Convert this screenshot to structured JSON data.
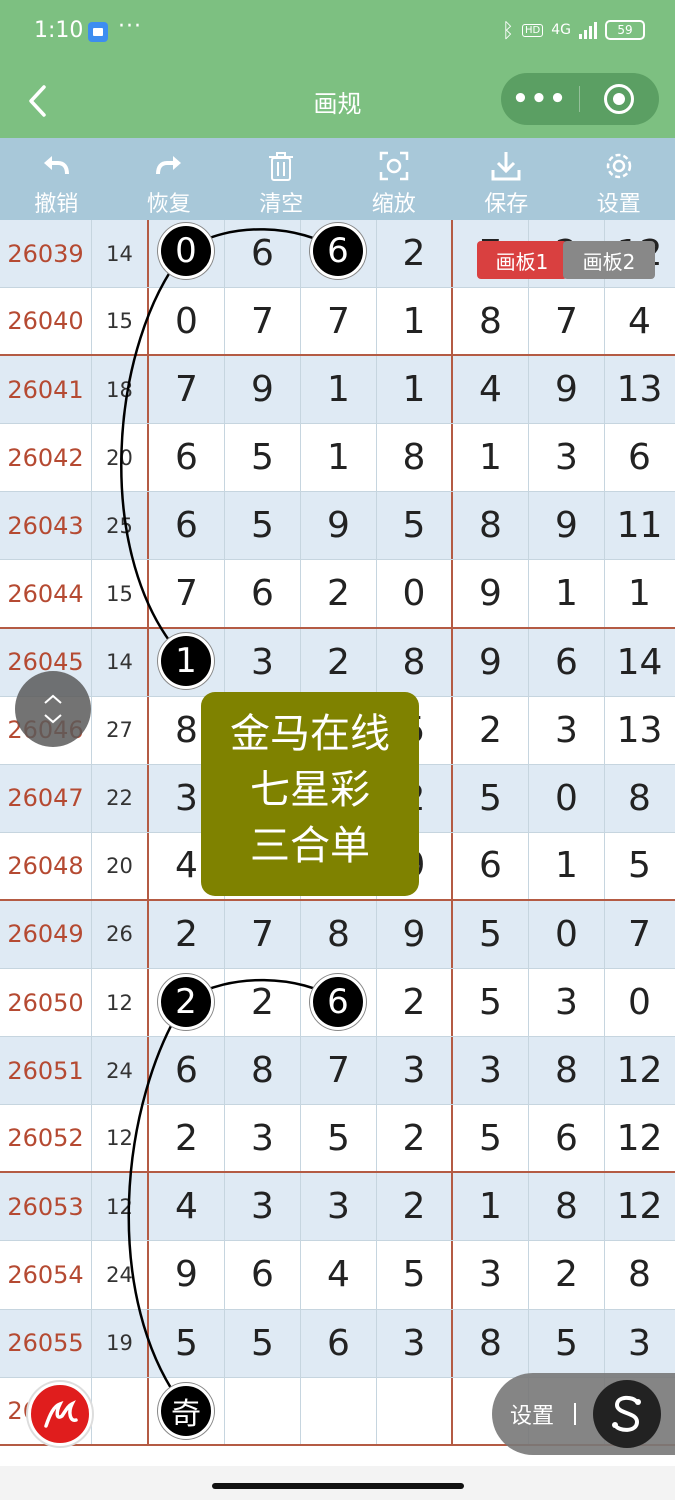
{
  "status_bar": {
    "time": "1:10",
    "dots": "···",
    "hd": "HD",
    "network": "4G",
    "battery": "59"
  },
  "nav": {
    "title": "画规",
    "more": "•••"
  },
  "toolbar": [
    {
      "label": "撤销",
      "icon": "undo-icon"
    },
    {
      "label": "恢复",
      "icon": "redo-icon"
    },
    {
      "label": "清空",
      "icon": "trash-icon"
    },
    {
      "label": "缩放",
      "icon": "zoom-icon"
    },
    {
      "label": "保存",
      "icon": "download-icon"
    },
    {
      "label": "设置",
      "icon": "gear-icon"
    }
  ],
  "boards": {
    "board1": "画板1",
    "board2": "画板2"
  },
  "rows": [
    {
      "id": "26039",
      "sum": "14",
      "n": [
        "0",
        "6",
        "6",
        "2",
        "7",
        "2",
        "12"
      ]
    },
    {
      "id": "26040",
      "sum": "15",
      "n": [
        "0",
        "7",
        "7",
        "1",
        "8",
        "7",
        "4"
      ]
    },
    {
      "id": "26041",
      "sum": "18",
      "n": [
        "7",
        "9",
        "1",
        "1",
        "4",
        "9",
        "13"
      ]
    },
    {
      "id": "26042",
      "sum": "20",
      "n": [
        "6",
        "5",
        "1",
        "8",
        "1",
        "3",
        "6"
      ]
    },
    {
      "id": "26043",
      "sum": "25",
      "n": [
        "6",
        "5",
        "9",
        "5",
        "8",
        "9",
        "11"
      ]
    },
    {
      "id": "26044",
      "sum": "15",
      "n": [
        "7",
        "6",
        "2",
        "0",
        "9",
        "1",
        "1"
      ]
    },
    {
      "id": "26045",
      "sum": "14",
      "n": [
        "1",
        "3",
        "2",
        "8",
        "9",
        "6",
        "14"
      ]
    },
    {
      "id": "26046",
      "sum": "27",
      "n": [
        "8",
        "",
        "",
        "5",
        "2",
        "3",
        "13"
      ]
    },
    {
      "id": "26047",
      "sum": "22",
      "n": [
        "3",
        "",
        "",
        "2",
        "5",
        "0",
        "8"
      ]
    },
    {
      "id": "26048",
      "sum": "20",
      "n": [
        "4",
        "",
        "",
        "9",
        "6",
        "1",
        "5"
      ]
    },
    {
      "id": "26049",
      "sum": "26",
      "n": [
        "2",
        "7",
        "8",
        "9",
        "5",
        "0",
        "7"
      ]
    },
    {
      "id": "26050",
      "sum": "12",
      "n": [
        "2",
        "2",
        "6",
        "2",
        "5",
        "3",
        "0"
      ]
    },
    {
      "id": "26051",
      "sum": "24",
      "n": [
        "6",
        "8",
        "7",
        "3",
        "3",
        "8",
        "12"
      ]
    },
    {
      "id": "26052",
      "sum": "12",
      "n": [
        "2",
        "3",
        "5",
        "2",
        "5",
        "6",
        "12"
      ]
    },
    {
      "id": "26053",
      "sum": "12",
      "n": [
        "4",
        "3",
        "3",
        "2",
        "1",
        "8",
        "12"
      ]
    },
    {
      "id": "26054",
      "sum": "24",
      "n": [
        "9",
        "6",
        "4",
        "5",
        "3",
        "2",
        "8"
      ]
    },
    {
      "id": "26055",
      "sum": "19",
      "n": [
        "5",
        "5",
        "6",
        "3",
        "8",
        "5",
        "3"
      ]
    },
    {
      "id": "26056",
      "sum": "",
      "n": [
        "",
        "",
        "",
        "",
        "",
        "",
        ""
      ]
    }
  ],
  "marks": {
    "m1": "0",
    "m2": "6",
    "m3": "1",
    "m4": "2",
    "m5": "6",
    "m6": "奇"
  },
  "watermark": {
    "line1": "金马在线",
    "line2": "七星彩",
    "line3": "三合单"
  },
  "settings": {
    "label": "设置",
    "s": "S"
  }
}
